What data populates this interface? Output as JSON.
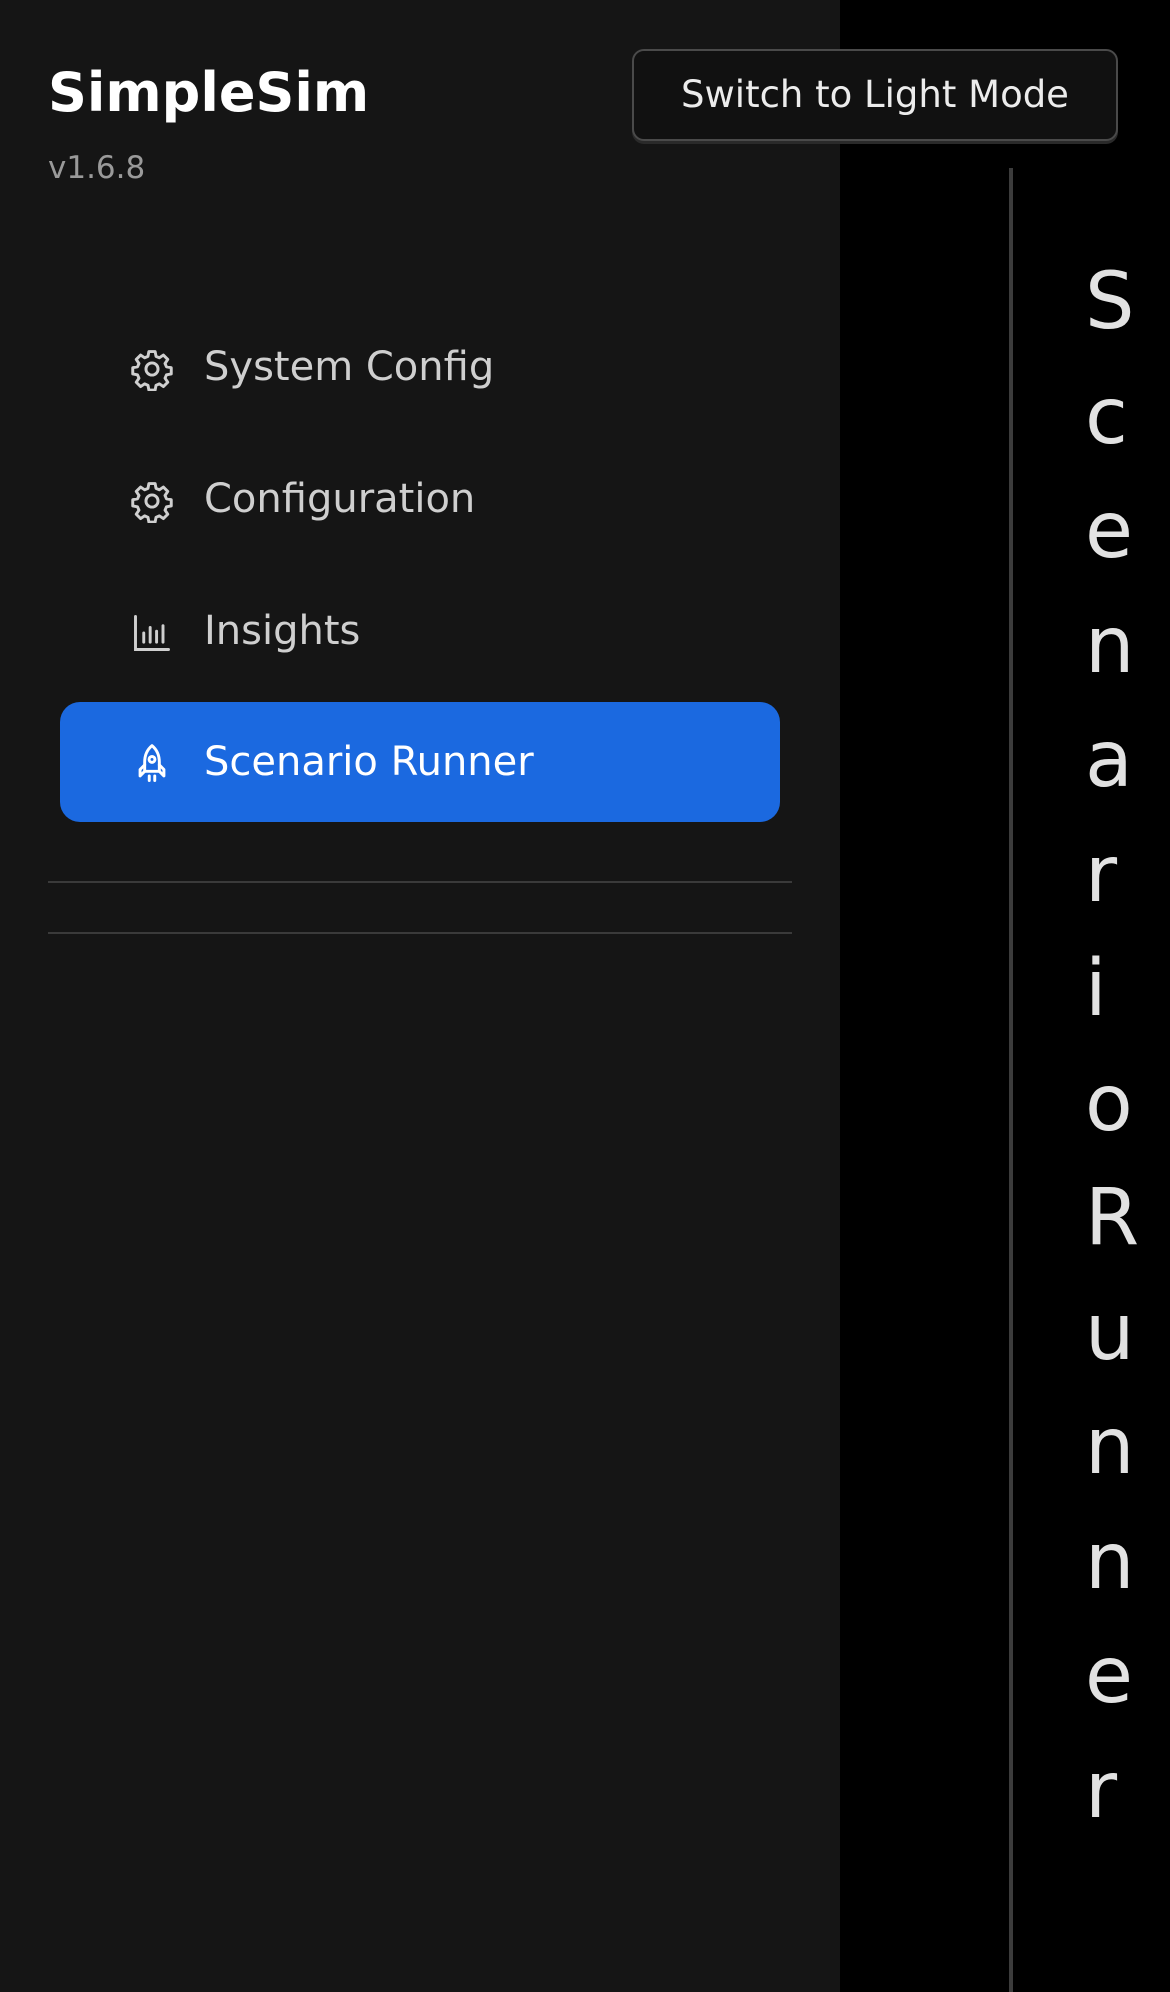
{
  "app": {
    "title": "SimpleSim",
    "version": "v1.6.8"
  },
  "header": {
    "theme_toggle_label": "Switch to Light Mode"
  },
  "sidebar": {
    "items": [
      {
        "label": "System Config",
        "icon": "gear-icon",
        "active": false
      },
      {
        "label": "Configuration",
        "icon": "gear-icon",
        "active": false
      },
      {
        "label": "Insights",
        "icon": "bar-chart-icon",
        "active": false
      },
      {
        "label": "Scenario Runner",
        "icon": "rocket-icon",
        "active": true
      }
    ]
  },
  "main": {
    "title": "ScenarioRunner"
  },
  "colors": {
    "sidebar_bg": "#151515",
    "main_bg": "#000000",
    "active_item": "#1b69e0",
    "text_primary": "#ffffff",
    "text_secondary": "#cfcfcf",
    "text_muted": "#9a9a9a"
  }
}
